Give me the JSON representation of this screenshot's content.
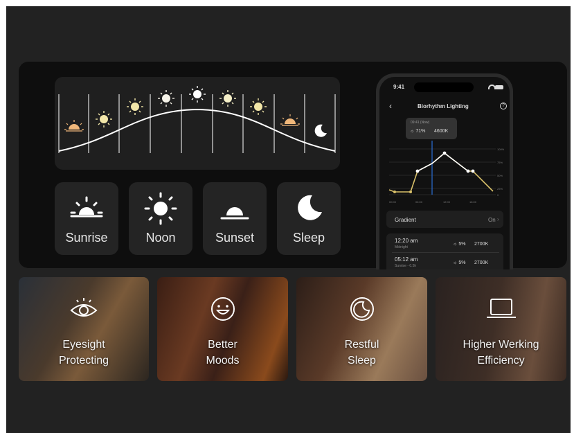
{
  "modes": [
    {
      "label": "Sunrise",
      "icon": "sunrise-icon"
    },
    {
      "label": "Noon",
      "icon": "sun-icon"
    },
    {
      "label": "Sunset",
      "icon": "sunset-icon"
    },
    {
      "label": "Sleep",
      "icon": "moon-icon"
    }
  ],
  "phone": {
    "time": "9:41",
    "title": "Biorhythm Lighting",
    "tooltip": {
      "time": "09:41 (Now)",
      "brightness": "71%",
      "temperature": "4600K"
    },
    "yticks": [
      "100%",
      "75%",
      "50%",
      "25%",
      "0"
    ],
    "xticks": [
      "00:00",
      "06:00",
      "12:00",
      "18:00"
    ],
    "gradient": {
      "label": "Gradient",
      "value": "On"
    },
    "schedule": [
      {
        "time": "12:20 am",
        "sub": "Midnight",
        "brightness": "5%",
        "temperature": "2700K"
      },
      {
        "time": "05:12 am",
        "sub": "Sunrise - 0.5h",
        "brightness": "5%",
        "temperature": "2700K"
      }
    ]
  },
  "features": [
    {
      "line1": "Eyesight",
      "line2": "Protecting",
      "icon": "eye-icon"
    },
    {
      "line1": "Better",
      "line2": "Moods",
      "icon": "smiley-icon"
    },
    {
      "line1": "Restful",
      "line2": "Sleep",
      "icon": "moon-icon"
    },
    {
      "line1": "Higher Werking",
      "line2": "Efficiency",
      "icon": "laptop-icon"
    }
  ],
  "colors": {
    "sun": "#f2e6a8",
    "sun_warm": "#f0b77a",
    "accent_line": "#ffffff",
    "curve_point": "#d8c070"
  }
}
